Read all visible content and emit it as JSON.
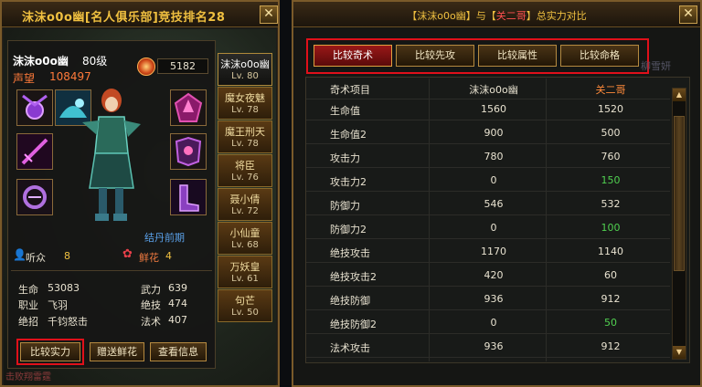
{
  "left_window": {
    "title": "沫沫o0o幽[名人俱乐部]竞技排名28",
    "close": "✕",
    "character": {
      "name": "沫沫o0o幽",
      "level": "80级",
      "fame_label": "声望",
      "fame_value": "108497",
      "power": "5182",
      "stage": "结丹前期",
      "audience_label": "听众",
      "audience_value": "8",
      "flowers_label": "鲜花",
      "flowers_value": "4"
    },
    "stats": [
      {
        "label": "生命",
        "value": "53083"
      },
      {
        "label": "武力",
        "value": "639"
      },
      {
        "label": "职业",
        "value": "飞羽"
      },
      {
        "label": "绝技",
        "value": "474"
      },
      {
        "label": "绝招",
        "value": "千钧怒击"
      },
      {
        "label": "法术",
        "value": "407"
      }
    ],
    "buttons": {
      "compare": "比较实力",
      "gift": "赠送鲜花",
      "view": "查看信息"
    },
    "footer_text": "击败翔雷霆",
    "ranking": [
      {
        "name": "沫沫o0o幽",
        "level": "Lv. 80"
      },
      {
        "name": "魔女夜魅",
        "level": "Lv. 78"
      },
      {
        "name": "魔王刑天",
        "level": "Lv. 78"
      },
      {
        "name": "将臣",
        "level": "Lv. 76"
      },
      {
        "name": "聂小倩",
        "level": "Lv. 72"
      },
      {
        "name": "小仙童",
        "level": "Lv. 68"
      },
      {
        "name": "万妖皇",
        "level": "Lv. 61"
      },
      {
        "name": "句芒",
        "level": "Lv. 50"
      }
    ]
  },
  "right_window": {
    "title_prefix": "【沫沫o0o幽】与【",
    "title_opponent": "关二哥",
    "title_suffix": "】总实力对比",
    "close": "✕",
    "tabs": [
      "比较奇术",
      "比较先攻",
      "比较属性",
      "比较命格"
    ],
    "active_tab": 0,
    "faint_text": "柳雪妍",
    "table": {
      "headers": [
        "奇术项目",
        "沫沫o0o幽",
        "关二哥"
      ],
      "rows": [
        {
          "item": "生命值",
          "self": "1560",
          "opponent": "1520",
          "opp_green": false
        },
        {
          "item": "生命值2",
          "self": "900",
          "opponent": "500",
          "opp_green": false
        },
        {
          "item": "攻击力",
          "self": "780",
          "opponent": "760",
          "opp_green": false
        },
        {
          "item": "攻击力2",
          "self": "0",
          "opponent": "150",
          "opp_green": true
        },
        {
          "item": "防御力",
          "self": "546",
          "opponent": "532",
          "opp_green": false
        },
        {
          "item": "防御力2",
          "self": "0",
          "opponent": "100",
          "opp_green": true
        },
        {
          "item": "绝技攻击",
          "self": "1170",
          "opponent": "1140",
          "opp_green": false
        },
        {
          "item": "绝技攻击2",
          "self": "420",
          "opponent": "60",
          "opp_green": false
        },
        {
          "item": "绝技防御",
          "self": "936",
          "opponent": "912",
          "opp_green": false
        },
        {
          "item": "绝技防御2",
          "self": "0",
          "opponent": "50",
          "opp_green": true
        },
        {
          "item": "法术攻击",
          "self": "936",
          "opponent": "912",
          "opp_green": false
        }
      ]
    }
  },
  "colors": {
    "gold": "#f0c040",
    "highlight_red": "#e0101a",
    "green": "#50d050",
    "orange": "#ff8a3a"
  },
  "icons": [
    "close-icon",
    "power-orb-icon",
    "audience-icon",
    "flower-icon",
    "scroll-up-icon",
    "scroll-down-icon"
  ]
}
